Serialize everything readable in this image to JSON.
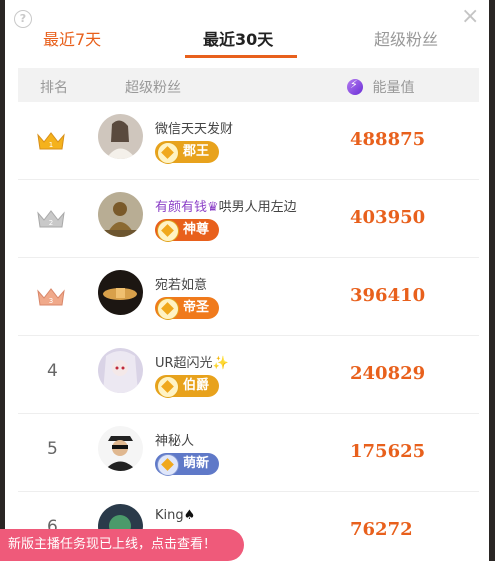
{
  "tabs": {
    "recent7": "最近7天",
    "recent30": "最近30天",
    "super_fans": "超级粉丝"
  },
  "header": {
    "rank": "排名",
    "fan": "超级粉丝",
    "energy": "能量值"
  },
  "rows": [
    {
      "rank": "1",
      "name": "微信天天发财",
      "badge": "郡王",
      "energy": "488875",
      "badge_color": "#e8a21c"
    },
    {
      "rank": "2",
      "name": "有颜有钱",
      "name_suffix": "哄男人用左边",
      "badge": "神尊",
      "energy": "403950",
      "badge_color": "#e8601c"
    },
    {
      "rank": "3",
      "name": "宛若如意",
      "badge": "帝圣",
      "energy": "396410",
      "badge_color": "#f07a1c"
    },
    {
      "rank": "4",
      "name": "UR超闪光",
      "badge": "伯爵",
      "energy": "240829",
      "badge_color": "#e8a21c"
    },
    {
      "rank": "5",
      "name": "神秘人",
      "badge": "萌新",
      "energy": "175625",
      "badge_color": "#5f79c8"
    },
    {
      "rank": "6",
      "name": "King",
      "badge": "",
      "energy": "76272",
      "badge_color": "#8b3fc7"
    }
  ],
  "toast": "新版主播任务现已上线，点击查看！",
  "colors": {
    "accent": "#e8601c",
    "toast_bg": "#ef5a7a"
  }
}
